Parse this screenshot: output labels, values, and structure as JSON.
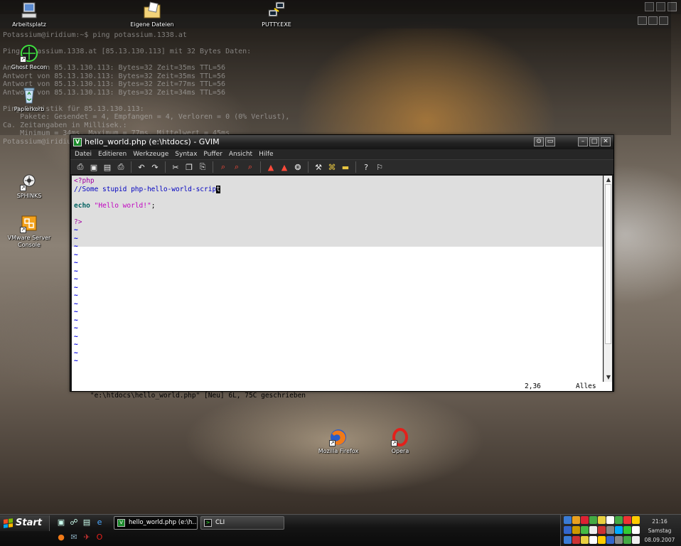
{
  "desktop": {
    "icons": [
      {
        "label": "Arbeitsplatz",
        "icon": "computer-icon"
      },
      {
        "label": "Eigene Dateien",
        "icon": "documents-folder-icon"
      },
      {
        "label": "PUTTY.EXE",
        "icon": "putty-icon"
      },
      {
        "label": "Ghost Recon",
        "icon": "ghost-recon-icon"
      },
      {
        "label": "Papierkorb",
        "icon": "recycle-bin-icon"
      },
      {
        "label": "SPHINKS",
        "icon": "sphinks-icon"
      },
      {
        "label": "VMware Server Console",
        "icon": "vmware-icon"
      },
      {
        "label": "Mozilla Firefox",
        "icon": "firefox-icon"
      },
      {
        "label": "Opera",
        "icon": "opera-icon"
      }
    ]
  },
  "console": {
    "lines": [
      "Potassium@iridium:~$ ping potassium.1338.at",
      "",
      "Ping potassium.1338.at [85.13.130.113] mit 32 Bytes Daten:",
      "",
      "Antwort von 85.13.130.113: Bytes=32 Zeit=35ms TTL=56",
      "Antwort von 85.13.130.113: Bytes=32 Zeit=35ms TTL=56",
      "Antwort von 85.13.130.113: Bytes=32 Zeit=77ms TTL=56",
      "Antwort von 85.13.130.113: Bytes=32 Zeit=34ms TTL=56",
      "",
      "Ping-Statistik für 85.13.130.113:",
      "    Pakete: Gesendet = 4, Empfangen = 4, Verloren = 0 (0% Verlust),",
      "Ca. Zeitangaben in Millisek.:",
      "    Minimum = 34ms, Maximum = 77ms, Mittelwert = 45ms",
      "Potassium@iridium:~$"
    ]
  },
  "gvim": {
    "title": "hello_world.php (e:\\htdocs) - GVIM",
    "menu": [
      "Datei",
      "Editieren",
      "Werkzeuge",
      "Syntax",
      "Puffer",
      "Ansicht",
      "Hilfe"
    ],
    "toolbar": [
      {
        "name": "open-icon",
        "glyph": "⎙"
      },
      {
        "name": "save-icon",
        "glyph": "▣"
      },
      {
        "name": "save-all-icon",
        "glyph": "▤"
      },
      {
        "name": "print-icon",
        "glyph": "⎙"
      },
      {
        "sep": true
      },
      {
        "name": "undo-icon",
        "glyph": "↶"
      },
      {
        "name": "redo-icon",
        "glyph": "↷"
      },
      {
        "sep": true
      },
      {
        "name": "cut-icon",
        "glyph": "✂"
      },
      {
        "name": "copy-icon",
        "glyph": "❐"
      },
      {
        "name": "paste-icon",
        "glyph": "⎘"
      },
      {
        "sep": true
      },
      {
        "name": "find-icon",
        "glyph": "⌕",
        "color": "red"
      },
      {
        "name": "find-next-icon",
        "glyph": "⌕",
        "color": "red"
      },
      {
        "name": "find-prev-icon",
        "glyph": "⌕",
        "color": "red"
      },
      {
        "sep": true
      },
      {
        "name": "load-session-icon",
        "glyph": "▲",
        "color": "red"
      },
      {
        "name": "save-session-icon",
        "glyph": "▲",
        "color": "red"
      },
      {
        "name": "run-script-icon",
        "glyph": "❂"
      },
      {
        "sep": true
      },
      {
        "name": "make-icon",
        "glyph": "⚒"
      },
      {
        "name": "shell-icon",
        "glyph": "⌘",
        "color": "yellow"
      },
      {
        "name": "tags-icon",
        "glyph": "▬",
        "color": "yellow"
      },
      {
        "sep": true
      },
      {
        "name": "help-icon",
        "glyph": "?"
      },
      {
        "name": "find-help-icon",
        "glyph": "⚐"
      }
    ],
    "code": [
      [
        {
          "t": "<?php",
          "c": "pre"
        }
      ],
      [
        {
          "t": "//Some stupid php-hello-world-scrip",
          "c": "comment"
        },
        {
          "t": "t",
          "c": "cursor"
        }
      ],
      [],
      [
        {
          "t": "echo",
          "c": "kw"
        },
        {
          "t": " ",
          "c": "plain"
        },
        {
          "t": "\"Hello world!\"",
          "c": "str"
        },
        {
          "t": ";",
          "c": "plain"
        }
      ],
      [],
      [
        {
          "t": "?>",
          "c": "pre"
        }
      ]
    ],
    "tilde_count": 17,
    "tilde_char": "~",
    "status_message": "\"e:\\htdocs\\hello_world.php\" [Neu] 6L, 75C geschrieben",
    "cursor_pos": "2,36",
    "scroll_pos": "Alles"
  },
  "taskbar": {
    "start_label": "Start",
    "tasks": [
      {
        "label": "hello_world.php (e:\\h...",
        "active": true
      },
      {
        "label": "CLI",
        "active": false
      }
    ],
    "clock": {
      "time": "21:16",
      "day": "Samstag",
      "date": "08.09.2007"
    }
  }
}
